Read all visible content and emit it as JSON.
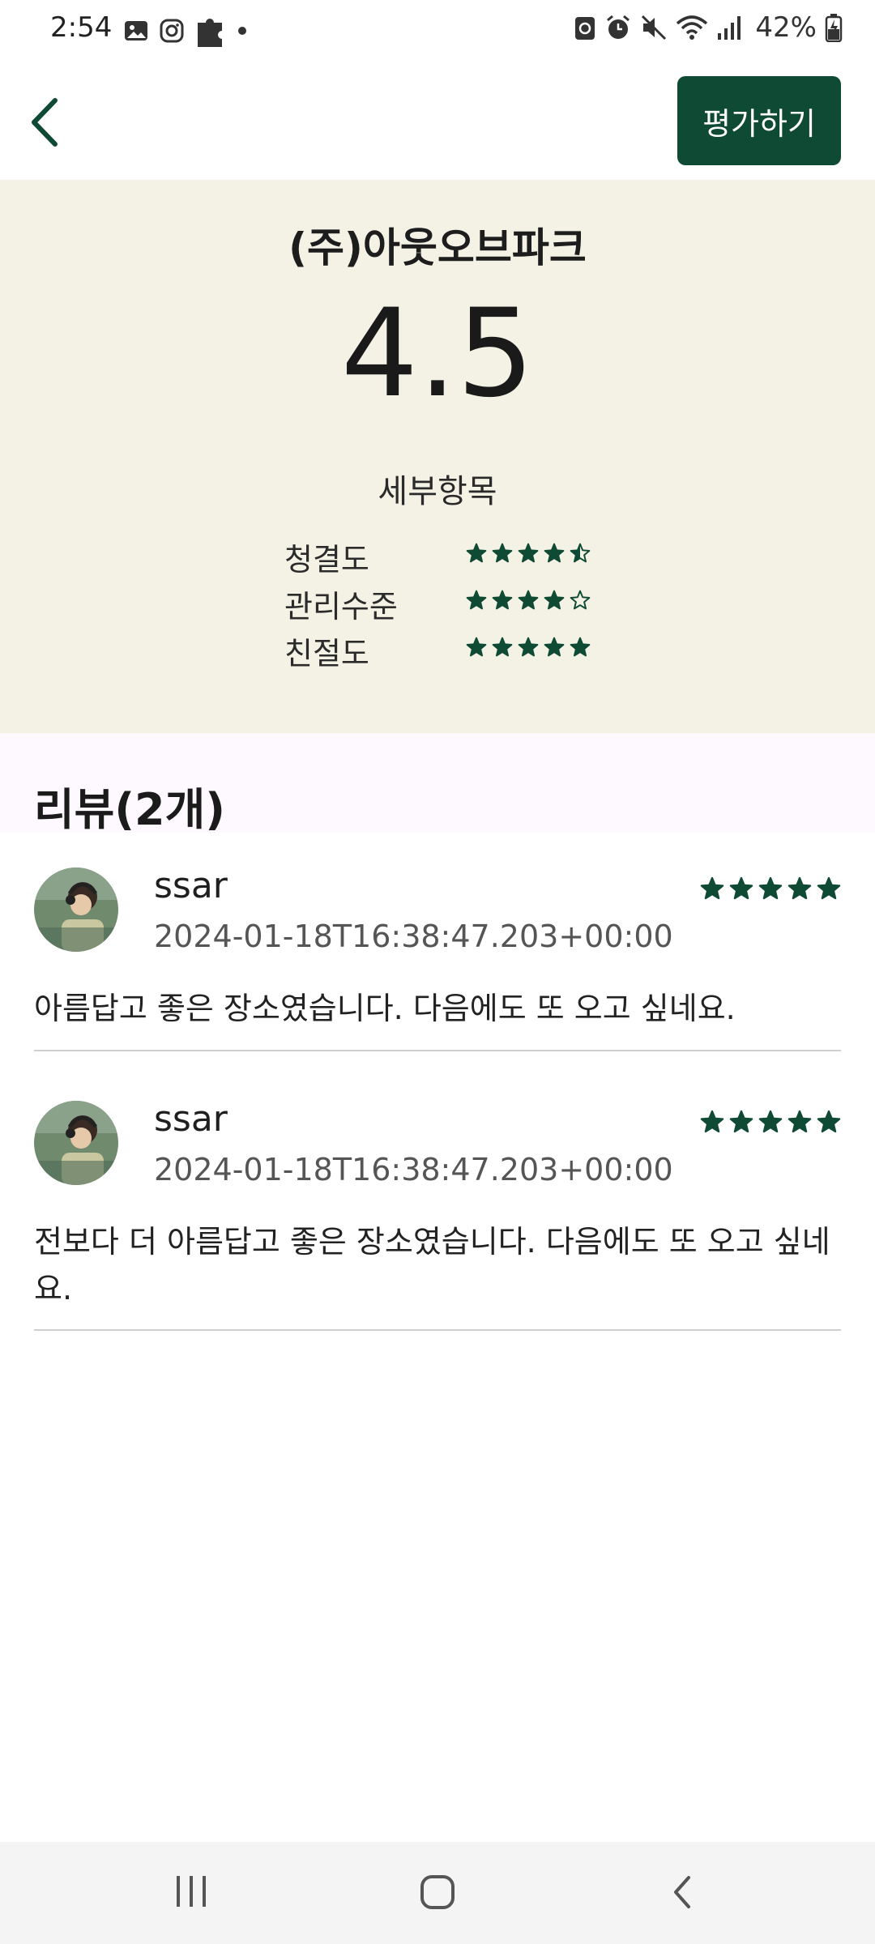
{
  "status_bar": {
    "time": "2:54",
    "battery_percent": "42%",
    "left_icons": [
      "gallery-icon",
      "instagram-icon",
      "puzzle-icon",
      "dot-icon"
    ],
    "right_icons": [
      "recycle-icon",
      "alarm-icon",
      "mute-icon",
      "wifi-icon",
      "signal-icon",
      "battery-icon"
    ]
  },
  "app_bar": {
    "back_icon": "chevron-left-icon",
    "rate_button_label": "평가하기"
  },
  "summary": {
    "company_name": "(주)아웃오브파크",
    "score": "4.5",
    "detail_title": "세부항목",
    "details": [
      {
        "label": "청결도",
        "rating": 4.5
      },
      {
        "label": "관리수준",
        "rating": 4
      },
      {
        "label": "친절도",
        "rating": 5
      }
    ]
  },
  "reviews": {
    "title": "리뷰(2개)",
    "items": [
      {
        "user": "ssar",
        "date": "2024-01-18T16:38:47.203+00:00",
        "rating": 5,
        "text": "아름답고 좋은 장소였습니다. 다음에도 또 오고 싶네요."
      },
      {
        "user": "ssar",
        "date": "2024-01-18T16:38:47.203+00:00",
        "rating": 5,
        "text": "전보다 더 아름답고 좋은 장소였습니다. 다음에도 또 오고 싶네요."
      }
    ]
  },
  "colors": {
    "accent": "#0f4a35",
    "summary_bg": "#f3f2e5",
    "reviews_header_bg": "#fdf9fe"
  },
  "nav_bar": {
    "icons": [
      "recent-apps-icon",
      "home-icon",
      "back-nav-icon"
    ]
  }
}
